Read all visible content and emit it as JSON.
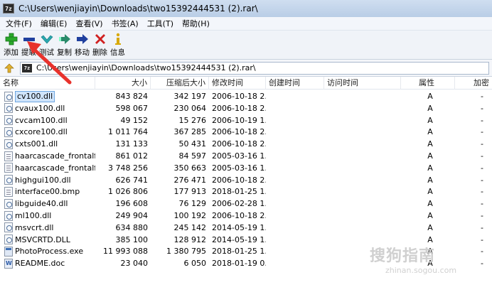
{
  "window": {
    "title": "C:\\Users\\wenjiayin\\Downloads\\two15392444531 (2).rar\\",
    "logo_text": "7z"
  },
  "menu": [
    "文件(F)",
    "编辑(E)",
    "查看(V)",
    "书签(A)",
    "工具(T)",
    "帮助(H)"
  ],
  "toolbar": [
    {
      "label": "添加",
      "icon": "plus-icon",
      "color": "#2aa82a"
    },
    {
      "label": "提取",
      "icon": "minus-icon",
      "color": "#1f3f9e"
    },
    {
      "label": "测试",
      "icon": "check-icon",
      "color": "#2aa8b0"
    },
    {
      "label": "复制",
      "icon": "copy-arrow-icon",
      "color": "#2a8a6a"
    },
    {
      "label": "移动",
      "icon": "move-arrow-icon",
      "color": "#1f3f9e"
    },
    {
      "label": "删除",
      "icon": "delete-x-icon",
      "color": "#d02020"
    },
    {
      "label": "信息",
      "icon": "info-icon",
      "color": "#d8a800"
    }
  ],
  "address": {
    "path": "C:\\Users\\wenjiayin\\Downloads\\two15392444531 (2).rar\\",
    "logo_text": "7z"
  },
  "columns": {
    "name": "名称",
    "size": "大小",
    "packed": "压缩后大小",
    "modified": "修改时间",
    "created": "创建时间",
    "accessed": "访问时间",
    "attributes": "属性",
    "encrypted": "加密"
  },
  "files": [
    {
      "name": "cv100.dll",
      "size": "843 824",
      "packed": "342 197",
      "modified": "2006-10-18 2...",
      "attr": "A",
      "enc": "-",
      "type": "dll",
      "selected": true
    },
    {
      "name": "cvaux100.dll",
      "size": "598 067",
      "packed": "230 064",
      "modified": "2006-10-18 2...",
      "attr": "A",
      "enc": "-",
      "type": "dll"
    },
    {
      "name": "cvcam100.dll",
      "size": "49 152",
      "packed": "15 276",
      "modified": "2006-10-19 1...",
      "attr": "A",
      "enc": "-",
      "type": "dll"
    },
    {
      "name": "cxcore100.dll",
      "size": "1 011 764",
      "packed": "367 285",
      "modified": "2006-10-18 2...",
      "attr": "A",
      "enc": "-",
      "type": "dll"
    },
    {
      "name": "cxts001.dll",
      "size": "131 133",
      "packed": "50 431",
      "modified": "2006-10-18 2...",
      "attr": "A",
      "enc": "-",
      "type": "dll"
    },
    {
      "name": "haarcascade_frontalfa...",
      "size": "861 012",
      "packed": "84 597",
      "modified": "2005-03-16 1...",
      "attr": "A",
      "enc": "-",
      "type": "txt"
    },
    {
      "name": "haarcascade_frontalfa...",
      "size": "3 748 256",
      "packed": "350 663",
      "modified": "2005-03-16 1...",
      "attr": "A",
      "enc": "-",
      "type": "txt"
    },
    {
      "name": "highgui100.dll",
      "size": "626 741",
      "packed": "276 471",
      "modified": "2006-10-18 2...",
      "attr": "A",
      "enc": "-",
      "type": "dll"
    },
    {
      "name": "interface00.bmp",
      "size": "1 026 806",
      "packed": "177 913",
      "modified": "2018-01-25 1...",
      "attr": "A",
      "enc": "-",
      "type": "txt"
    },
    {
      "name": "libguide40.dll",
      "size": "196 608",
      "packed": "76 129",
      "modified": "2006-02-28 1...",
      "attr": "A",
      "enc": "-",
      "type": "dll"
    },
    {
      "name": "ml100.dll",
      "size": "249 904",
      "packed": "100 192",
      "modified": "2006-10-18 2...",
      "attr": "A",
      "enc": "-",
      "type": "dll"
    },
    {
      "name": "msvcrt.dll",
      "size": "634 880",
      "packed": "245 142",
      "modified": "2014-05-19 1...",
      "attr": "A",
      "enc": "-",
      "type": "dll"
    },
    {
      "name": "MSVCRTD.DLL",
      "size": "385 100",
      "packed": "128 912",
      "modified": "2014-05-19 1...",
      "attr": "A",
      "enc": "-",
      "type": "dll"
    },
    {
      "name": "PhotoProcess.exe",
      "size": "11 993 088",
      "packed": "1 380 795",
      "modified": "2018-01-25 1...",
      "attr": "A",
      "enc": "-",
      "type": "exe"
    },
    {
      "name": "README.doc",
      "size": "23 040",
      "packed": "6 050",
      "modified": "2018-01-19 0...",
      "attr": "A",
      "enc": "-",
      "type": "doc"
    }
  ],
  "watermark": {
    "main": "搜狗指南",
    "sub": "zhinan.sogou.com"
  },
  "annotation": {
    "color": "#e8322c"
  }
}
